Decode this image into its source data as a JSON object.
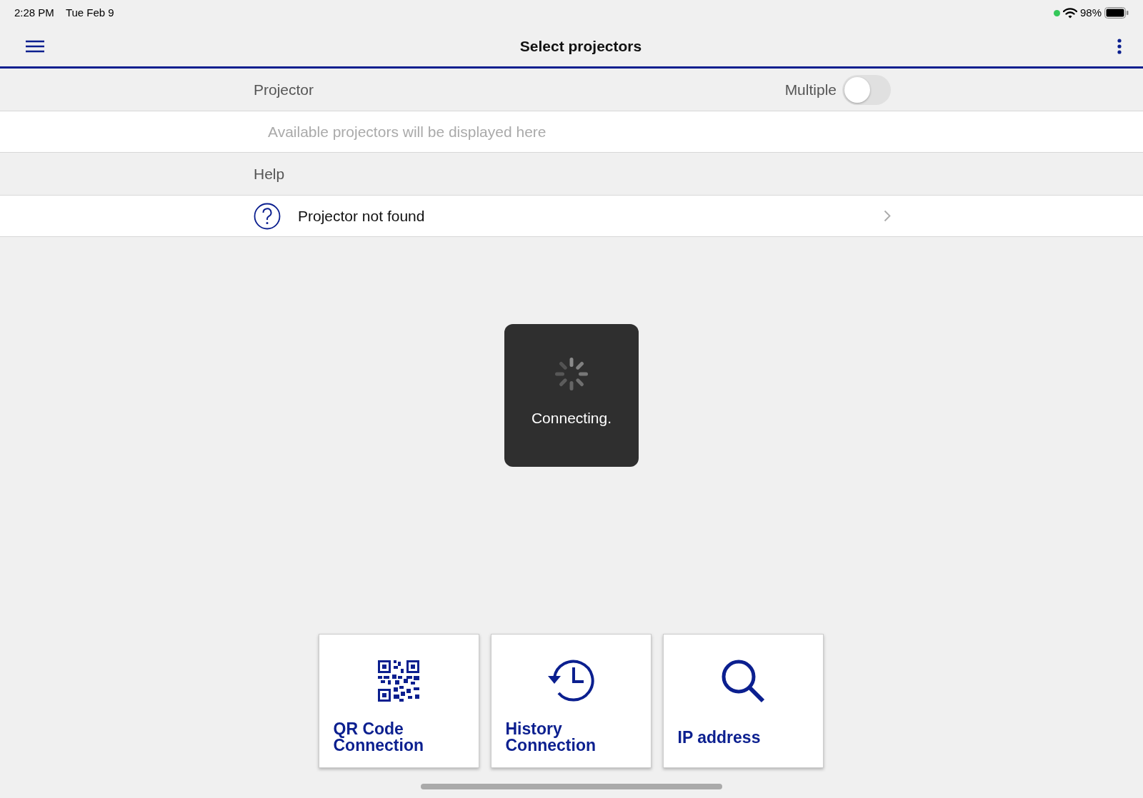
{
  "status_bar": {
    "time": "2:28 PM",
    "date": "Tue Feb 9",
    "battery": "98%"
  },
  "header": {
    "title": "Select projectors"
  },
  "projector_section": {
    "title": "Projector",
    "multiple": {
      "label": "Multiple",
      "on": false
    },
    "empty_text": "Available projectors will be displayed here"
  },
  "help_section": {
    "title": "Help",
    "items": [
      {
        "label": "Projector not found"
      }
    ]
  },
  "toast": {
    "text": "Connecting."
  },
  "tiles": [
    {
      "kind": "qr",
      "label": "QR Code Connection"
    },
    {
      "kind": "history",
      "label": "History Connection"
    },
    {
      "kind": "search",
      "label": "IP address"
    }
  ]
}
